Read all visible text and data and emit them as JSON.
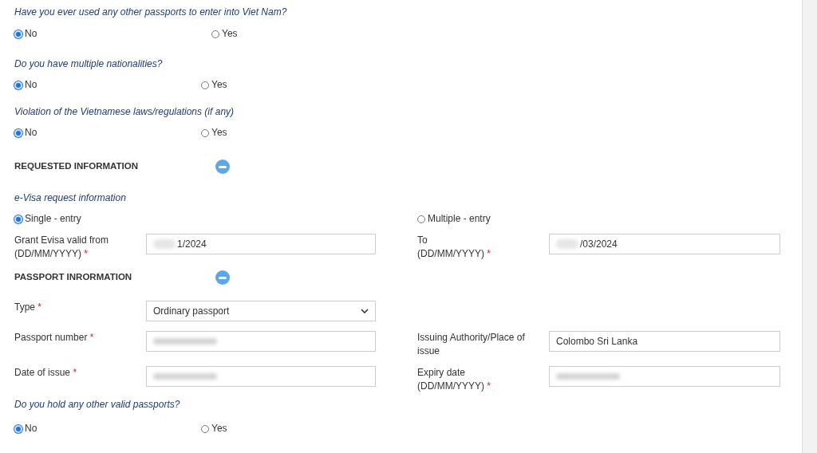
{
  "questions_top": [
    {
      "question": "Have you ever used any other passports to enter into Viet Nam?",
      "options": [
        {
          "label": "No",
          "selected": true
        },
        {
          "label": "Yes",
          "selected": false
        }
      ]
    },
    {
      "question": "Do you have multiple nationalities?",
      "options": [
        {
          "label": "No",
          "selected": true
        },
        {
          "label": "Yes",
          "selected": false
        }
      ]
    },
    {
      "question": "Violation of the Vietnamese laws/regulations (if any)",
      "options": [
        {
          "label": "No",
          "selected": true
        },
        {
          "label": "Yes",
          "selected": false
        }
      ]
    }
  ],
  "requested_section": {
    "title": "REQUESTED INFORMATION",
    "expanded": true
  },
  "evisa": {
    "heading": "e-Visa request information",
    "options": [
      {
        "label": "Single - entry",
        "selected": true
      },
      {
        "label": "Multiple - entry",
        "selected": false
      }
    ]
  },
  "validity_row": [
    {
      "label_lines": [
        "Grant Evisa valid from",
        "(DD/MM/YYYY)"
      ],
      "required_mark": "*",
      "value": "1/2024",
      "redacted": true
    },
    {
      "label_lines": [
        "To",
        "(DD/MM/YYYY)"
      ],
      "required_mark": "*",
      "value": "/03/2024",
      "redacted": true
    }
  ],
  "passport_section": {
    "title": "PASSPORT INRORMATION",
    "expanded": true
  },
  "passport_rows": [
    [
      {
        "kind": "select",
        "label_lines": [
          "Type"
        ],
        "required_mark": "*",
        "value": "Ordinary passport"
      }
    ],
    [
      {
        "kind": "text",
        "label_lines": [
          "Passport number"
        ],
        "required_mark": "*",
        "redacted": true
      },
      {
        "kind": "text",
        "label_lines": [
          "Issuing Authority/Place of",
          "issue"
        ],
        "value": "Colombo Sri Lanka"
      }
    ],
    [
      {
        "kind": "text",
        "label_lines": [
          "Date of issue"
        ],
        "required_mark": "*",
        "redacted": true
      },
      {
        "kind": "text",
        "label_lines": [
          "Expiry date",
          "(DD/MM/YYYY)"
        ],
        "required_mark": "*",
        "redacted": true
      }
    ]
  ],
  "question_bottom": {
    "question": "Do you hold any other valid passports?",
    "options": [
      {
        "label": "No",
        "selected": true
      },
      {
        "label": "Yes",
        "selected": false
      }
    ]
  }
}
